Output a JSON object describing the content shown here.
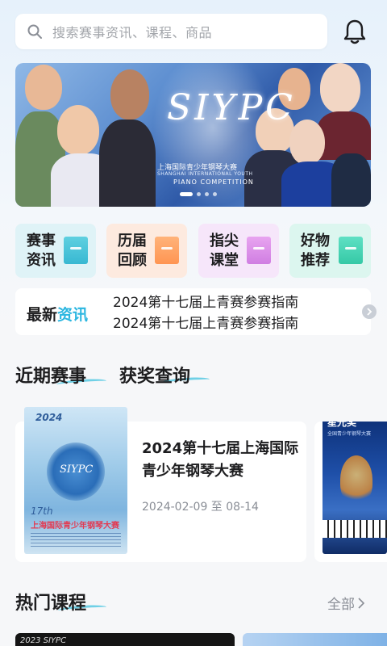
{
  "search": {
    "placeholder": "搜索赛事资讯、课程、商品"
  },
  "banner": {
    "logo_text": "SIYPC",
    "cn_title": "上海国际青少年钢琴大赛",
    "en_title": "SHANGHAI INTERNATIONAL YOUTH",
    "en_subtitle": "PIANO COMPETITION"
  },
  "quick_entries": [
    {
      "label": "赛事资讯",
      "color": "#dff3f7"
    },
    {
      "label": "历届回顾",
      "color": "#fdeadf"
    },
    {
      "label": "指尖课堂",
      "color": "#f6e6fa"
    },
    {
      "label": "好物推荐",
      "color": "#dcf6ef"
    }
  ],
  "news": {
    "tag_prefix": "最新",
    "tag_accent": "资讯",
    "items": [
      "2024第十七届上青赛参赛指南",
      "2024第十七届上青赛参赛指南"
    ]
  },
  "tabs": {
    "recent": "近期赛事",
    "awards": "获奖查询"
  },
  "events": [
    {
      "title": "2024第十七届上海国际青少年钢琴大赛",
      "date": "2024-02-09 至 08-14",
      "poster": {
        "year": "2024",
        "logo": "SIYPC",
        "edition": "17th",
        "cn_title": "上海国际青少年钢琴大赛"
      }
    },
    {
      "poster": {
        "brand": "星光奖",
        "subtitle": "全国青少年钢琴大赛"
      }
    }
  ],
  "hot_courses": {
    "title": "热门课程",
    "all_label": "全部",
    "items": [
      {
        "label": "2023 SIYPC"
      },
      {
        "label": ""
      }
    ]
  },
  "colors": {
    "accent": "#2bb6e0",
    "swoosh": "#6fd0e6"
  }
}
